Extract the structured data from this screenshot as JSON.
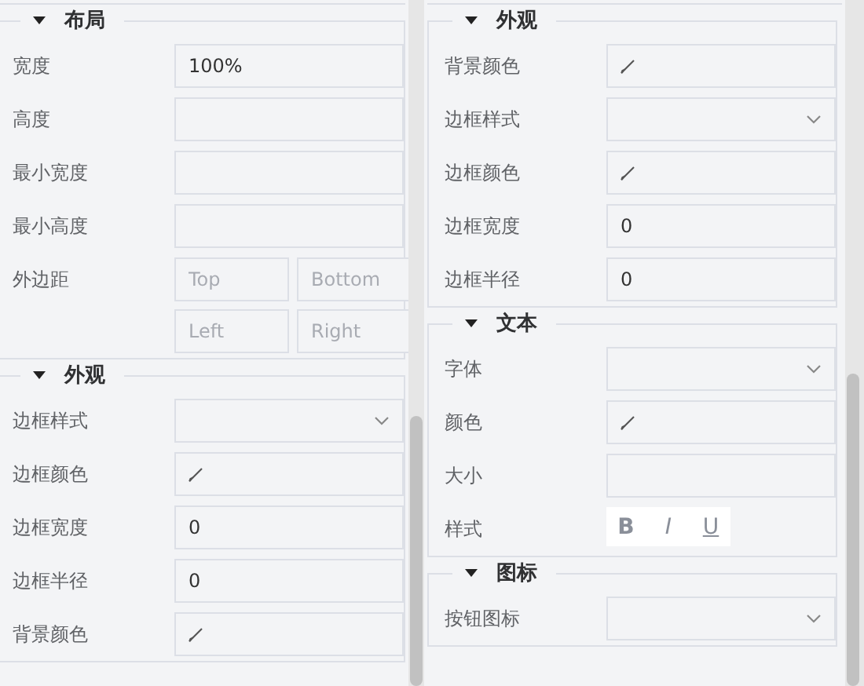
{
  "panels": [
    {
      "sections": [
        {
          "title": "布局",
          "expanded": true,
          "fields": [
            {
              "kind": "text",
              "label": "宽度",
              "value": "100%"
            },
            {
              "kind": "text",
              "label": "高度"
            },
            {
              "kind": "text",
              "label": "最小宽度"
            },
            {
              "kind": "text",
              "label": "最小高度"
            },
            {
              "kind": "margin",
              "label": "外边距",
              "placeholders": [
                "Top",
                "Bottom",
                "Left",
                "Right"
              ]
            }
          ]
        },
        {
          "title": "外观",
          "expanded": true,
          "fields": [
            {
              "kind": "select",
              "label": "边框样式"
            },
            {
              "kind": "color",
              "label": "边框颜色"
            },
            {
              "kind": "text",
              "label": "边框宽度",
              "value": "0"
            },
            {
              "kind": "text",
              "label": "边框半径",
              "value": "0"
            },
            {
              "kind": "color",
              "label": "背景颜色"
            }
          ]
        }
      ]
    },
    {
      "sections": [
        {
          "title": "外观",
          "expanded": true,
          "fields": [
            {
              "kind": "color",
              "label": "背景颜色"
            },
            {
              "kind": "select",
              "label": "边框样式"
            },
            {
              "kind": "color",
              "label": "边框颜色"
            },
            {
              "kind": "text",
              "label": "边框宽度",
              "value": "0"
            },
            {
              "kind": "text",
              "label": "边框半径",
              "value": "0"
            }
          ]
        },
        {
          "title": "文本",
          "expanded": true,
          "fields": [
            {
              "kind": "select",
              "label": "字体"
            },
            {
              "kind": "color",
              "label": "颜色"
            },
            {
              "kind": "text",
              "label": "大小"
            },
            {
              "kind": "style",
              "label": "样式",
              "buttons": [
                {
                  "label": "B",
                  "on": false
                },
                {
                  "label": "I",
                  "on": false
                },
                {
                  "label": "U",
                  "on": false
                }
              ]
            }
          ]
        },
        {
          "title": "图标",
          "expanded": true,
          "fields": [
            {
              "kind": "select",
              "label": "按钮图标"
            }
          ]
        }
      ]
    }
  ]
}
